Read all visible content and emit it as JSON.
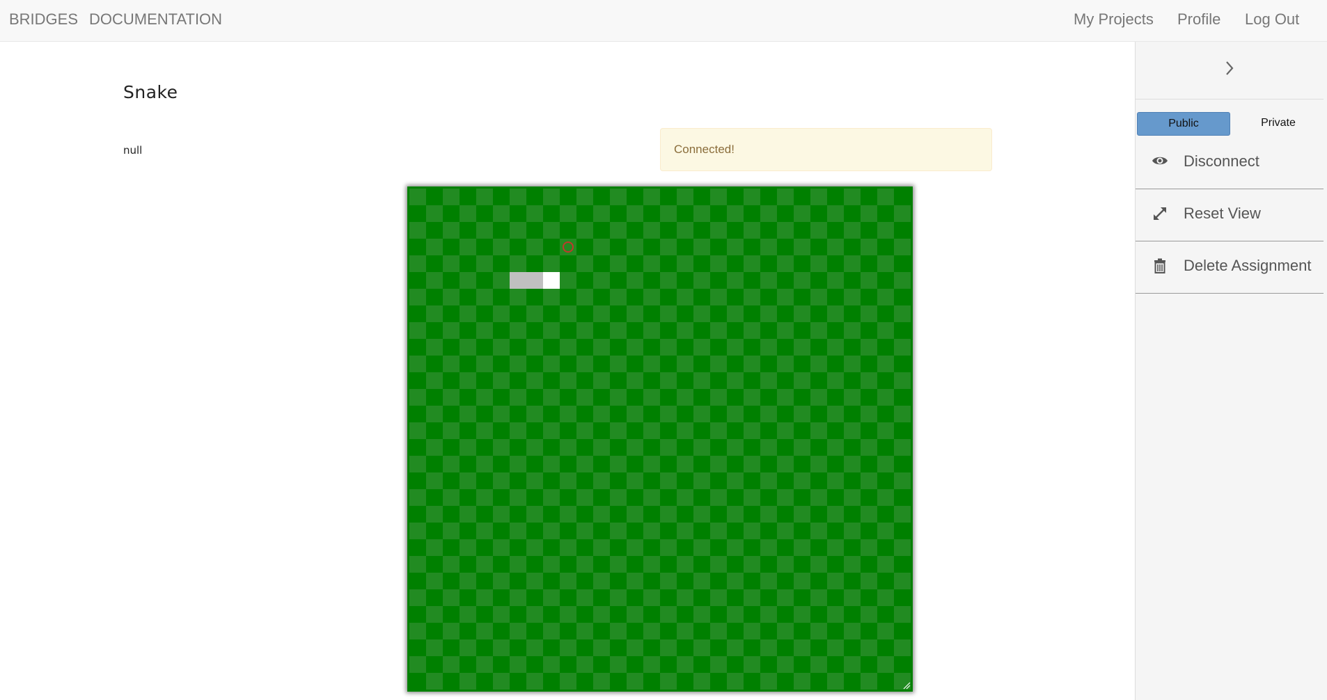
{
  "nav": {
    "brand": "BRIDGES",
    "documentation": "DOCUMENTATION",
    "my_projects": "My Projects",
    "profile": "Profile",
    "logout": "Log Out"
  },
  "assignment": {
    "title": "Snake",
    "description": "null"
  },
  "status": {
    "message": "Connected!"
  },
  "game": {
    "grid_cols": 30,
    "grid_rows": 30,
    "colors": {
      "dark": "#008000",
      "light": "#228b22",
      "snake_body": "#c0c0c0",
      "snake_head": "#ffffff",
      "apple": "#c0392b"
    },
    "snake_body": [
      [
        6,
        5
      ],
      [
        7,
        5
      ]
    ],
    "snake_head": [
      8,
      5
    ],
    "apple": [
      9,
      3
    ]
  },
  "sidebar": {
    "public_label": "Public",
    "private_label": "Private",
    "disconnect_label": "Disconnect",
    "reset_label": "Reset View",
    "delete_label": "Delete Assignment",
    "icons": {
      "collapse": "chevron-right-icon",
      "disconnect": "eye-icon",
      "reset": "expand-icon",
      "delete": "trash-icon"
    }
  }
}
